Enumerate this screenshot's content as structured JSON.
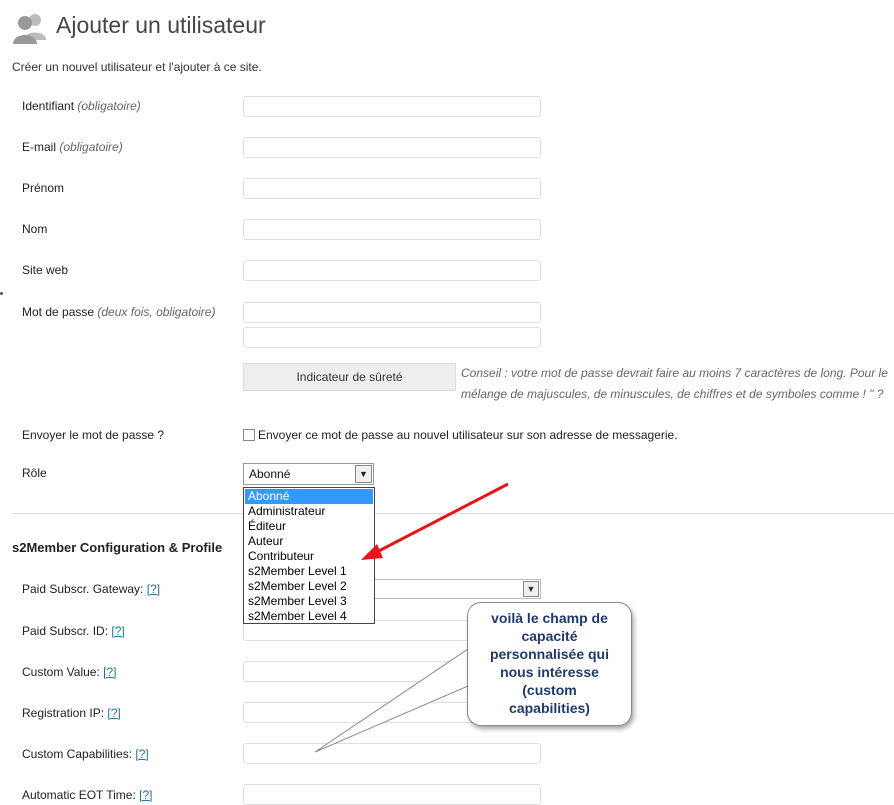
{
  "header": {
    "title": "Ajouter un utilisateur",
    "icon": "users-icon",
    "intro": "Créer un nouvel utilisateur et l'ajouter à ce site."
  },
  "form": {
    "username_label": "Identifiant",
    "username_req": "(obligatoire)",
    "email_label": "E-mail",
    "email_req": "(obligatoire)",
    "firstname_label": "Prénom",
    "lastname_label": "Nom",
    "website_label": "Site web",
    "password_label": "Mot de passe",
    "password_req": "(deux fois, obligatoire)",
    "strength_label": "Indicateur de sûreté",
    "hint_line1": "Conseil : votre mot de passe devrait faire au moins 7 caractères de long. Pour le",
    "hint_line2": "mélange de majuscules, de minuscules, de chiffres et de symboles comme ! \" ?",
    "send_label": "Envoyer le mot de passe ?",
    "send_checkbox_label": "Envoyer ce mot de passe au nouvel utilisateur sur son adresse de messagerie.",
    "send_checked": false,
    "role_label": "Rôle",
    "role_value": "Abonné",
    "role_options": [
      "Abonné",
      "Administrateur",
      "Éditeur",
      "Auteur",
      "Contributeur",
      "s2Member Level 1",
      "s2Member Level 2",
      "s2Member Level 3",
      "s2Member Level 4"
    ]
  },
  "s2member": {
    "section_title": "s2Member Configuration & Profile",
    "help": "[?]",
    "gateway_label": "Paid Subscr. Gateway:",
    "subscr_id_label": "Paid Subscr. ID:",
    "custom_value_label": "Custom Value:",
    "reg_ip_label": "Registration IP:",
    "custom_caps_label": "Custom Capabilities:",
    "eot_label": "Automatic EOT Time:"
  },
  "annotation": {
    "lines": [
      "voilà le champ de",
      "capacité",
      "personnalisée qui",
      "nous intéresse",
      "(custom",
      "capabilities)"
    ],
    "arrow_color": "#e8141a",
    "text_color": "#1f3a6e"
  }
}
